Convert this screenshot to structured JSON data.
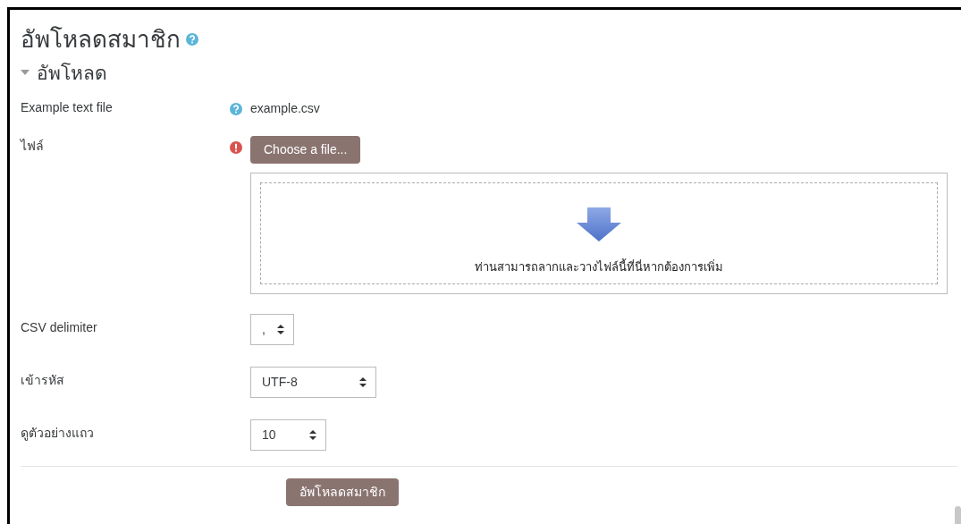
{
  "title": "อัพโหลดสมาชิก",
  "section": {
    "label": "อัพโหลด",
    "expanded": true
  },
  "fields": [
    {
      "kind": "static",
      "label": "Example text file",
      "help": true,
      "value": "example.csv"
    },
    {
      "kind": "filepicker",
      "label": "ไฟล์",
      "required": true,
      "button": "Choose a file...",
      "drop_hint": "ท่านสามารถลากและวางไฟล์นี้ที่นี่หากต้องการเพิ่ม"
    },
    {
      "kind": "select",
      "label": "CSV delimiter",
      "value": ","
    },
    {
      "kind": "select",
      "label": "เข้ารหัส",
      "value": "UTF-8"
    },
    {
      "kind": "select",
      "label": "ดูตัวอย่างแถว",
      "value": "10"
    }
  ],
  "submit": "อัพโหลดสมาชิก"
}
